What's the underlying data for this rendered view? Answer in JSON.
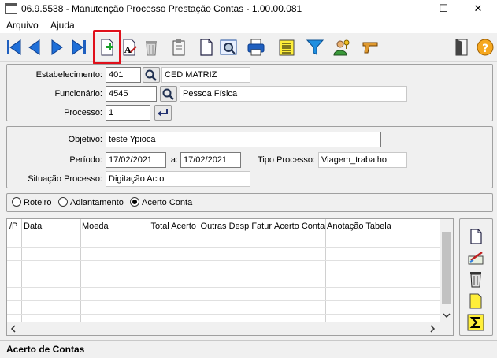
{
  "window": {
    "title": "06.9.5538 - Manutenção Processo Prestação Contas - 1.00.00.081",
    "minimize": "—",
    "maximize": "☐",
    "close": "✕"
  },
  "menu": {
    "items": [
      "Arquivo",
      "Ajuda"
    ]
  },
  "toolbar": {
    "icons": [
      "first-record-icon",
      "previous-record-icon",
      "next-record-icon",
      "last-record-icon",
      "new-record-icon",
      "edit-text-icon",
      "delete-icon",
      "clipboard-icon",
      "document-icon",
      "preview-icon",
      "print-icon",
      "list-icon",
      "filter-icon",
      "user-key-icon",
      "pistol-icon",
      "exit-door-icon",
      "help-icon"
    ],
    "highlight_color": "#e0101b"
  },
  "form": {
    "estabelecimento": {
      "label": "Estabelecimento:",
      "code": "401",
      "name": "CED MATRIZ"
    },
    "funcionario": {
      "label": "Funcionário:",
      "code": "4545",
      "name": "Pessoa Física"
    },
    "processo": {
      "label": "Processo:",
      "value": "1"
    },
    "objetivo": {
      "label": "Objetivo:",
      "value": "teste Ypioca"
    },
    "periodo": {
      "label": "Período:",
      "from": "17/02/2021",
      "sep": "a:",
      "to": "17/02/2021"
    },
    "tipo_processo": {
      "label": "Tipo Processo:",
      "value": "Viagem_trabalho"
    },
    "situacao": {
      "label": "Situação Processo:",
      "value": "Digitação Acto"
    }
  },
  "radios": [
    {
      "label": "Roteiro",
      "checked": false
    },
    {
      "label": "Adiantamento",
      "checked": false
    },
    {
      "label": "Acerto Conta",
      "checked": true
    }
  ],
  "grid": {
    "columns": [
      "/P",
      "Data",
      "Moeda",
      "Total Acerto",
      "Outras Desp Fatur",
      "Acerto Conta",
      "Anotação Tabela"
    ]
  },
  "status": {
    "text": "Acerto de Contas"
  }
}
